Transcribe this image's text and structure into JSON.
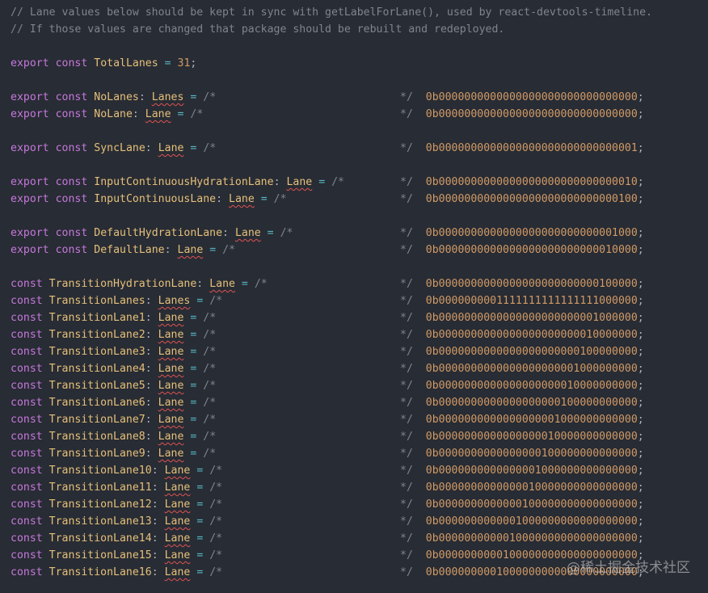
{
  "syntax": {
    "export_kw": "export",
    "const_kw": "const",
    "eq": "=",
    "colon": ":",
    "semicolon": ";",
    "comment_open": "/*",
    "comment_close": "*/"
  },
  "comments": [
    "// Lane values below should be kept in sync with getLabelForLane(), used by react-devtools-timeline.",
    "// If those values are changed that package should be rebuilt and redeployed."
  ],
  "total_lanes": {
    "name": "TotalLanes",
    "value": "31"
  },
  "lanes": [
    {
      "exported": true,
      "name": "NoLanes",
      "type": "Lanes",
      "value": "0b0000000000000000000000000000000",
      "group_gap": true
    },
    {
      "exported": true,
      "name": "NoLane",
      "type": "Lane",
      "value": "0b0000000000000000000000000000000",
      "group_gap": false
    },
    {
      "exported": true,
      "name": "SyncLane",
      "type": "Lane",
      "value": "0b0000000000000000000000000000001",
      "group_gap": true
    },
    {
      "exported": true,
      "name": "InputContinuousHydrationLane",
      "type": "Lane",
      "value": "0b0000000000000000000000000000010",
      "group_gap": true
    },
    {
      "exported": true,
      "name": "InputContinuousLane",
      "type": "Lane",
      "value": "0b0000000000000000000000000000100",
      "group_gap": false
    },
    {
      "exported": true,
      "name": "DefaultHydrationLane",
      "type": "Lane",
      "value": "0b0000000000000000000000000001000",
      "group_gap": true
    },
    {
      "exported": true,
      "name": "DefaultLane",
      "type": "Lane",
      "value": "0b0000000000000000000000000010000",
      "group_gap": false
    },
    {
      "exported": false,
      "name": "TransitionHydrationLane",
      "type": "Lane",
      "value": "0b0000000000000000000000000100000",
      "group_gap": true
    },
    {
      "exported": false,
      "name": "TransitionLanes",
      "type": "Lanes",
      "value": "0b0000000001111111111111111000000",
      "group_gap": false
    },
    {
      "exported": false,
      "name": "TransitionLane1",
      "type": "Lane",
      "value": "0b0000000000000000000000001000000",
      "group_gap": false
    },
    {
      "exported": false,
      "name": "TransitionLane2",
      "type": "Lane",
      "value": "0b0000000000000000000000010000000",
      "group_gap": false
    },
    {
      "exported": false,
      "name": "TransitionLane3",
      "type": "Lane",
      "value": "0b0000000000000000000000100000000",
      "group_gap": false
    },
    {
      "exported": false,
      "name": "TransitionLane4",
      "type": "Lane",
      "value": "0b0000000000000000000001000000000",
      "group_gap": false
    },
    {
      "exported": false,
      "name": "TransitionLane5",
      "type": "Lane",
      "value": "0b0000000000000000000010000000000",
      "group_gap": false
    },
    {
      "exported": false,
      "name": "TransitionLane6",
      "type": "Lane",
      "value": "0b0000000000000000000100000000000",
      "group_gap": false
    },
    {
      "exported": false,
      "name": "TransitionLane7",
      "type": "Lane",
      "value": "0b0000000000000000001000000000000",
      "group_gap": false
    },
    {
      "exported": false,
      "name": "TransitionLane8",
      "type": "Lane",
      "value": "0b0000000000000000010000000000000",
      "group_gap": false
    },
    {
      "exported": false,
      "name": "TransitionLane9",
      "type": "Lane",
      "value": "0b0000000000000000100000000000000",
      "group_gap": false
    },
    {
      "exported": false,
      "name": "TransitionLane10",
      "type": "Lane",
      "value": "0b0000000000000001000000000000000",
      "group_gap": false
    },
    {
      "exported": false,
      "name": "TransitionLane11",
      "type": "Lane",
      "value": "0b0000000000000010000000000000000",
      "group_gap": false
    },
    {
      "exported": false,
      "name": "TransitionLane12",
      "type": "Lane",
      "value": "0b0000000000000100000000000000000",
      "group_gap": false
    },
    {
      "exported": false,
      "name": "TransitionLane13",
      "type": "Lane",
      "value": "0b0000000000001000000000000000000",
      "group_gap": false
    },
    {
      "exported": false,
      "name": "TransitionLane14",
      "type": "Lane",
      "value": "0b0000000000010000000000000000000",
      "group_gap": false
    },
    {
      "exported": false,
      "name": "TransitionLane15",
      "type": "Lane",
      "value": "0b0000000000100000000000000000000",
      "group_gap": false
    },
    {
      "exported": false,
      "name": "TransitionLane16",
      "type": "Lane",
      "value": "0b0000000001000000000000000000000",
      "group_gap": false
    }
  ],
  "watermark": "@稀土掘金技术社区",
  "colors": {
    "background": "#282c34",
    "comment": "#7f848e",
    "keyword": "#c678dd",
    "identifier": "#e5c07b",
    "operator": "#56b6c2",
    "number": "#d19a66",
    "squiggle": "#e05252"
  }
}
